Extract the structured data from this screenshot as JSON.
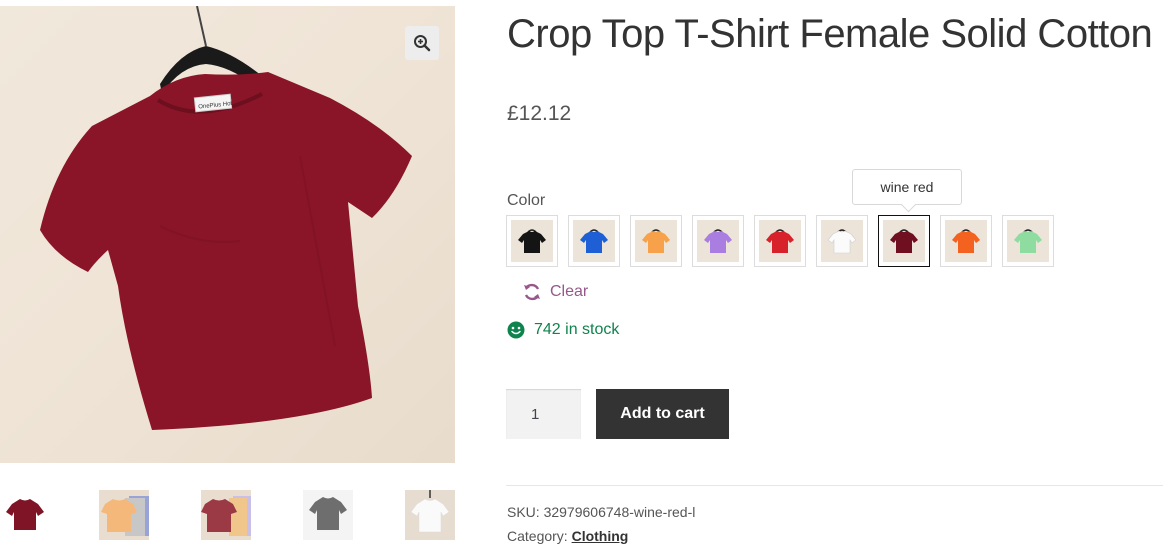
{
  "gallery": {
    "zoom_icon": "zoom-in-icon",
    "main_shirt_color": "#8a1528",
    "hanger_label": "OnePlus Hot",
    "thumbnails": [
      {
        "name": "thumb-wine-red",
        "color": "#7e1426",
        "bg": "#ffffff"
      },
      {
        "name": "thumb-orange-stack",
        "color": "#f4b87a",
        "bg": "#e9ddd0"
      },
      {
        "name": "thumb-wine-stack",
        "color": "#9b3a45",
        "bg": "#e9ddd0"
      },
      {
        "name": "thumb-grey",
        "color": "#6e6e6e",
        "bg": "#ffffff"
      },
      {
        "name": "thumb-white",
        "color": "#fafafa",
        "bg": "#e6dccf"
      }
    ]
  },
  "product": {
    "title": "Crop Top T-Shirt Female Solid Cotton",
    "price": "£12.12",
    "color_label": "Color",
    "tooltip": "wine red",
    "swatches": [
      {
        "name": "black",
        "color": "#141414"
      },
      {
        "name": "blue",
        "color": "#1f5fd6"
      },
      {
        "name": "orange",
        "color": "#f7a24a"
      },
      {
        "name": "purple",
        "color": "#a97ee0"
      },
      {
        "name": "red",
        "color": "#d8222b"
      },
      {
        "name": "white",
        "color": "#fbfbfb"
      },
      {
        "name": "wine red",
        "color": "#6f0f20",
        "selected": true
      },
      {
        "name": "bright orange",
        "color": "#f4621f"
      },
      {
        "name": "mint green",
        "color": "#8fdca0"
      }
    ],
    "clear_label": "Clear",
    "clear_icon": "refresh-icon",
    "stock_icon": "smiley-icon",
    "stock_text": "742 in stock",
    "quantity": "1",
    "add_to_cart_label": "Add to cart",
    "sku_label": "SKU:",
    "sku_value": "32979606748-wine-red-l",
    "category_label": "Category:",
    "category_value": "Clothing"
  },
  "colors": {
    "accent": "#96588a",
    "stock": "#0f834d",
    "button": "#333333"
  }
}
